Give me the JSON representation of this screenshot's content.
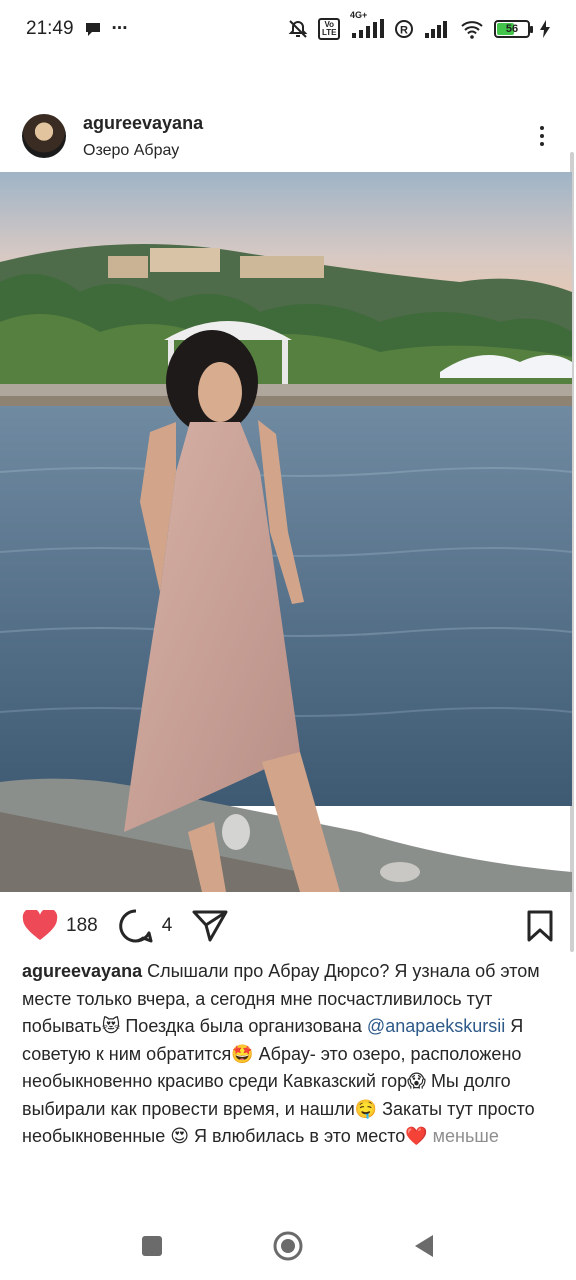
{
  "status_bar": {
    "time": "21:49",
    "left_icons": [
      "chat-bubble-icon",
      "more-dots-icon"
    ],
    "more_text": "···",
    "network_label": "4G+",
    "volte_label": "Vo LTE",
    "battery_level": "56",
    "icons": [
      "mute-bell-icon",
      "volte-icon",
      "signal-icon",
      "registered-icon",
      "signal-2-icon",
      "wifi-icon",
      "battery-icon",
      "charging-icon"
    ]
  },
  "post": {
    "username": "agureevayana",
    "location": "Озеро Абрау",
    "likes": "188",
    "comments": "4",
    "caption": {
      "username": "agureevayana",
      "part1": " Слышали про Абрау Дюрсо? Я узнала об этом месте только вчера, а сегодня мне посчастливилось тут побывать😻 Поездка была организована ",
      "mention": "@anapaekskursii",
      "part2": "  Я советую к ним обратится🤩 Абрау- это озеро, расположено необыкновенно красиво среди Кавказский гор😱 Мы долго выбирали как провести время, и нашли🤤 Закаты тут просто необыкновенные 😍 Я влюбилась в это место❤️ ",
      "less": "меньше"
    }
  },
  "colors": {
    "like_red": "#ed4956",
    "text": "#262626",
    "mention": "#2e5a8a",
    "muted": "#8e8e8e"
  },
  "nav_bar": {
    "icons": [
      "recent-apps-icon",
      "home-icon",
      "back-icon"
    ]
  }
}
